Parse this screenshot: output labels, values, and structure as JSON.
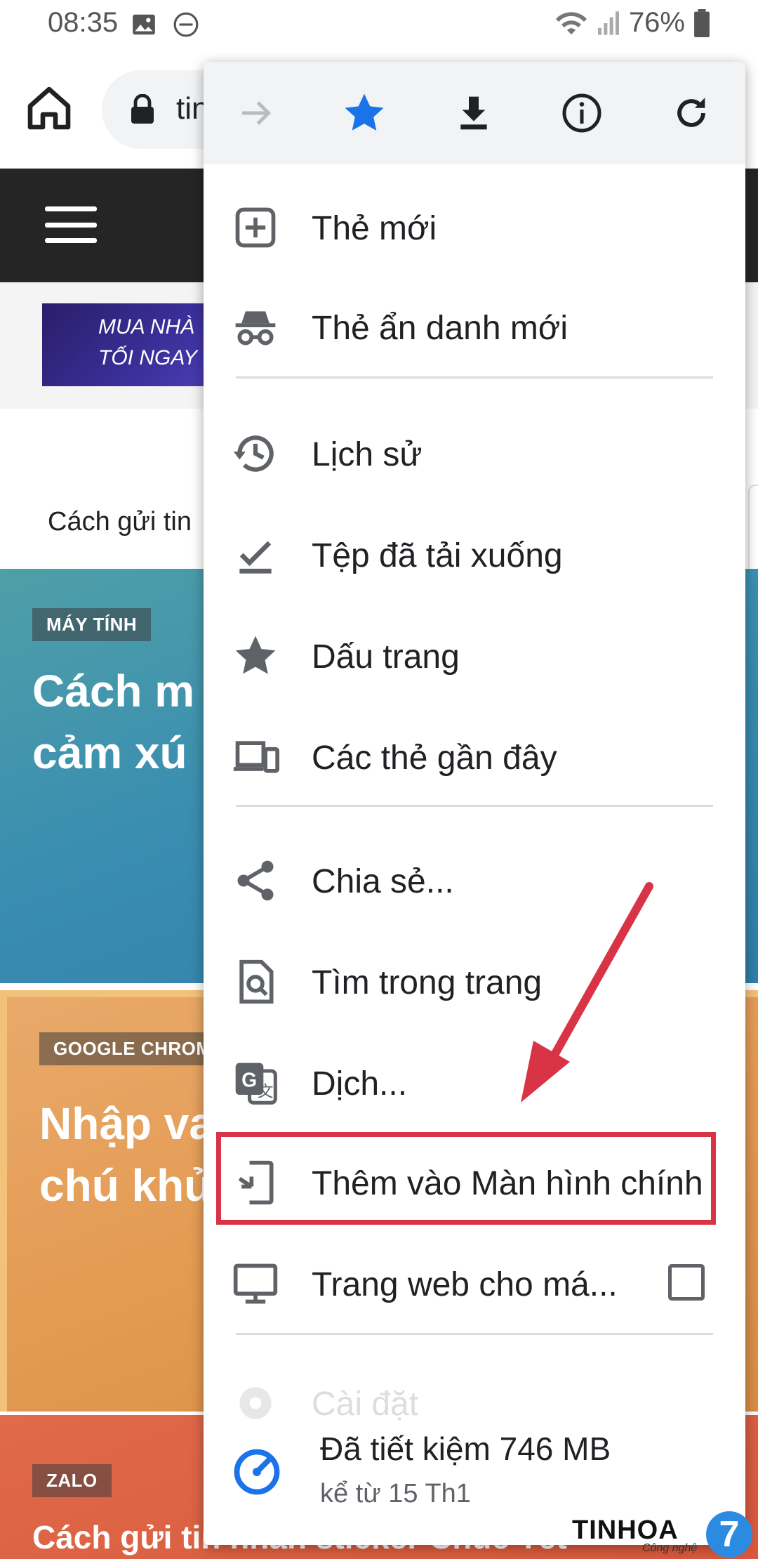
{
  "status_bar": {
    "time": "08:35",
    "battery": "76%",
    "icons": [
      "gallery-icon",
      "dnd-icon",
      "wifi-icon",
      "signal-icon",
      "battery-icon"
    ]
  },
  "browser": {
    "url_partial": "tin",
    "icons": [
      "home-icon",
      "lock-icon"
    ]
  },
  "page": {
    "ad_text_line1": "MUA NHÀ",
    "ad_text_line2": "TỐI NGAY",
    "breadcrumb": "Cách gửi tin",
    "cards": [
      {
        "tag": "MÁY TÍNH",
        "title": "Cách m\ncảm xú"
      },
      {
        "tag": "GOOGLE CHROM",
        "title": "Nhập va\nchú khủ"
      },
      {
        "tag": "ZALO",
        "title": "Cách gửi tin nhắn sticker Chúc Tết"
      }
    ]
  },
  "menu": {
    "action_bar": [
      "forward-icon",
      "bookmark-star-icon",
      "download-icon",
      "info-icon",
      "refresh-icon"
    ],
    "items": [
      {
        "id": "new-tab",
        "label": "Thẻ mới",
        "icon": "plus-box-icon"
      },
      {
        "id": "incognito",
        "label": "Thẻ ẩn danh mới",
        "icon": "incognito-icon"
      },
      {
        "id": "history",
        "label": "Lịch sử",
        "icon": "history-icon"
      },
      {
        "id": "downloads",
        "label": "Tệp đã tải xuống",
        "icon": "download-check-icon"
      },
      {
        "id": "bookmarks",
        "label": "Dấu trang",
        "icon": "star-icon"
      },
      {
        "id": "recent-tabs",
        "label": "Các thẻ gần đây",
        "icon": "devices-icon"
      },
      {
        "id": "share",
        "label": "Chia sẻ...",
        "icon": "share-icon"
      },
      {
        "id": "find",
        "label": "Tìm trong trang",
        "icon": "find-in-page-icon"
      },
      {
        "id": "translate",
        "label": "Dịch...",
        "icon": "translate-icon"
      },
      {
        "id": "add-home",
        "label": "Thêm vào Màn hình chính",
        "icon": "add-to-home-icon"
      },
      {
        "id": "desktop-site",
        "label": "Trang web cho má...",
        "icon": "monitor-icon"
      },
      {
        "id": "settings",
        "label": "Cài đặt",
        "icon": "gear-icon"
      }
    ],
    "saved": {
      "title": "Đã tiết kiệm 746 MB",
      "subtitle": "kể từ 15 Th1",
      "icon": "data-saver-icon"
    }
  },
  "watermark": {
    "brand": "TINHOA",
    "sub": "Công nghệ",
    "badge": "7"
  },
  "colors": {
    "accent_blue": "#1a73e8",
    "highlight_red": "#d93346",
    "header_dark": "#252525",
    "icon_gray": "#5f6368"
  }
}
